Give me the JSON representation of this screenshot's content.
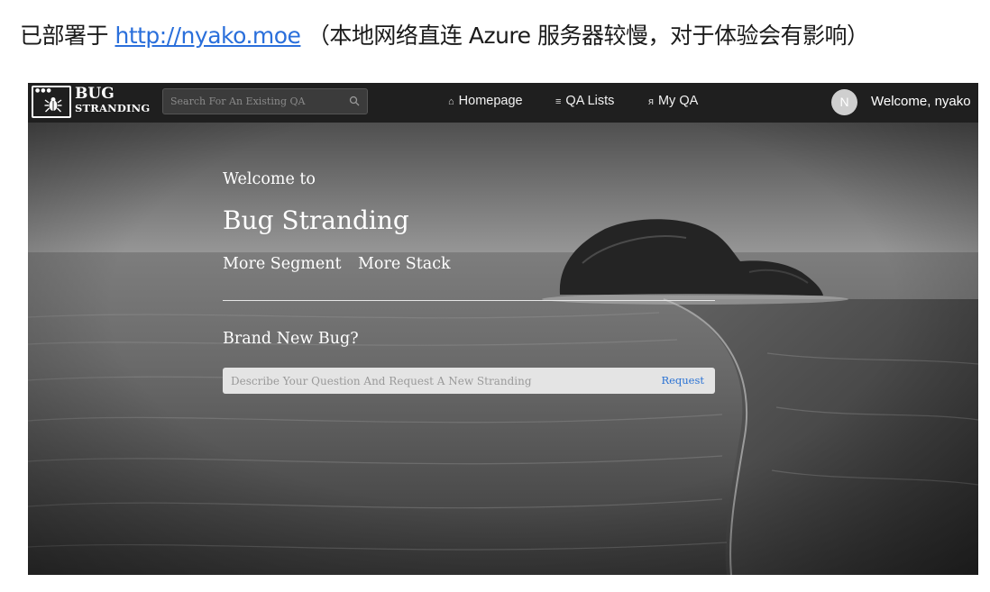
{
  "caption": {
    "prefix": "已部署于",
    "link": "http://nyako.moe",
    "suffix": "（本地网络直连 Azure 服务器较慢，对于体验会有影响）"
  },
  "brand": {
    "line1": "BUG",
    "line2": "STRANDING"
  },
  "search": {
    "placeholder": "Search For An Existing QA"
  },
  "nav": {
    "homepage": "Homepage",
    "qa_lists": "QA Lists",
    "my_qa": "My QA"
  },
  "user": {
    "avatar_letter": "N",
    "welcome": "Welcome, nyako"
  },
  "hero": {
    "welcome": "Welcome to",
    "title": "Bug Stranding",
    "link_segment": "More Segment",
    "link_stack": "More Stack",
    "brand_new": "Brand New Bug?",
    "request_placeholder": "Describe Your Question And Request A New Stranding",
    "request_button": "Request"
  },
  "colors": {
    "navbar": "#1f1f1f",
    "link_blue": "#2a72d4"
  }
}
